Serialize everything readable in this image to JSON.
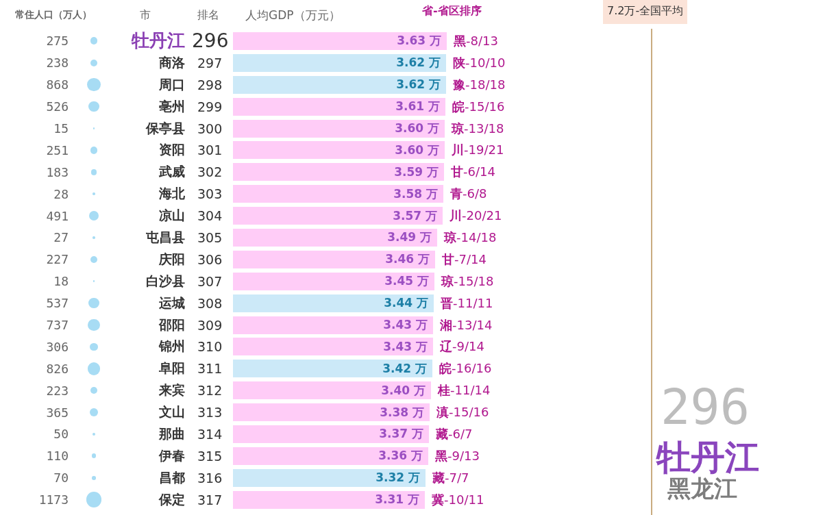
{
  "headers": {
    "population": "常住人口（万人）",
    "city": "市",
    "rank": "排名",
    "gdp": "人均GDP（万元）",
    "province_rank": "省-省区排序"
  },
  "national_average": {
    "label": "7.2万-全国平均"
  },
  "rows": [
    {
      "population": "275",
      "city": "牡丹江",
      "rank": "296",
      "value": "3.63 万",
      "color": "#ffccf7",
      "province": "**黑**-8/13",
      "selected": true
    },
    {
      "population": "238",
      "city": "商洛",
      "rank": "297",
      "value": "3.62 万",
      "color": "#cce9f8",
      "province": "**陕**-10/10",
      "selected": false
    },
    {
      "population": "868",
      "city": "周口",
      "rank": "298",
      "value": "3.62 万",
      "color": "#cce9f8",
      "province": "**豫**-18/18",
      "selected": false
    },
    {
      "population": "526",
      "city": "亳州",
      "rank": "299",
      "value": "3.61 万",
      "color": "#ffccf7",
      "province": "**皖**-15/16",
      "selected": false
    },
    {
      "population": "15",
      "city": "保亭县",
      "rank": "300",
      "value": "3.60 万",
      "color": "#ffccf7",
      "province": "**琼**-13/18",
      "selected": false
    },
    {
      "population": "251",
      "city": "资阳",
      "rank": "301",
      "value": "3.60 万",
      "color": "#ffccf7",
      "province": "**川**-19/21",
      "selected": false
    },
    {
      "population": "183",
      "city": "武威",
      "rank": "302",
      "value": "3.59 万",
      "color": "#ffccf7",
      "province": "**甘**-6/14",
      "selected": false
    },
    {
      "population": "28",
      "city": "海北",
      "rank": "303",
      "value": "3.58 万",
      "color": "#ffccf7",
      "province": "**青**-6/8",
      "selected": false
    },
    {
      "population": "491",
      "city": "凉山",
      "rank": "304",
      "value": "3.57 万",
      "color": "#ffccf7",
      "province": "**川**-20/21",
      "selected": false
    },
    {
      "population": "27",
      "city": "屯昌县",
      "rank": "305",
      "value": "3.49 万",
      "color": "#ffccf7",
      "province": "**琼**-14/18",
      "selected": false
    },
    {
      "population": "227",
      "city": "庆阳",
      "rank": "306",
      "value": "3.46 万",
      "color": "#ffccf7",
      "province": "**甘**-7/14",
      "selected": false
    },
    {
      "population": "18",
      "city": "白沙县",
      "rank": "307",
      "value": "3.45 万",
      "color": "#ffccf7",
      "province": "**琼**-15/18",
      "selected": false
    },
    {
      "population": "537",
      "city": "运城",
      "rank": "308",
      "value": "3.44 万",
      "color": "#cce9f8",
      "province": "**晋**-11/11",
      "selected": false
    },
    {
      "population": "737",
      "city": "邵阳",
      "rank": "309",
      "value": "3.43 万",
      "color": "#ffccf7",
      "province": "**湘**-13/14",
      "selected": false
    },
    {
      "population": "306",
      "city": "锦州",
      "rank": "310",
      "value": "3.43 万",
      "color": "#ffccf7",
      "province": "**辽**-9/14",
      "selected": false
    },
    {
      "population": "826",
      "city": "阜阳",
      "rank": "311",
      "value": "3.42 万",
      "color": "#cce9f8",
      "province": "**皖**-16/16",
      "selected": false
    },
    {
      "population": "223",
      "city": "来宾",
      "rank": "312",
      "value": "3.40 万",
      "color": "#ffccf7",
      "province": "**桂**-11/14",
      "selected": false
    },
    {
      "population": "365",
      "city": "文山",
      "rank": "313",
      "value": "3.38 万",
      "color": "#ffccf7",
      "province": "**滇**-15/16",
      "selected": false
    },
    {
      "population": "50",
      "city": "那曲",
      "rank": "314",
      "value": "3.37 万",
      "color": "#ffccf7",
      "province": "**藏**-6/7",
      "selected": false
    },
    {
      "population": "110",
      "city": "伊春",
      "rank": "315",
      "value": "3.36 万",
      "color": "#ffccf7",
      "province": "**黑**-9/13",
      "selected": false
    },
    {
      "population": "70",
      "city": "昌都",
      "rank": "316",
      "value": "3.32 万",
      "color": "#cce9f8",
      "province": "**藏**-7/7",
      "selected": false
    },
    {
      "population": "1173",
      "city": "保定",
      "rank": "317",
      "value": "3.31 万",
      "color": "#ffccf7",
      "province": "**冀**-10/11",
      "selected": false
    }
  ],
  "focus": {
    "rank": "296",
    "city": "牡丹江",
    "province": "黑龙江"
  }
}
